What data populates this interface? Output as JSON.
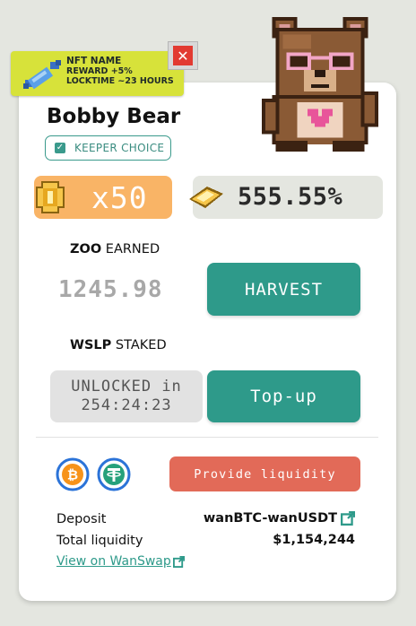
{
  "nft": {
    "name": "NFT NAME",
    "reward": "REWARD +5%",
    "locktime": "LOCKTIME ~23 HOURS"
  },
  "card": {
    "title": "Bobby Bear",
    "keeper_label": "KEEPER CHOICE",
    "multiplier": "x50",
    "apr": "555.55%",
    "earned": {
      "token": "ZOO",
      "suffix": " EARNED",
      "value": "1245.98",
      "button": "HARVEST"
    },
    "staked": {
      "token": "WSLP",
      "suffix": " STAKED",
      "status_line1": "UNLOCKED in",
      "status_line2": "254:24:23",
      "button": "Top-up"
    },
    "provide_button": "Provide liquidity",
    "deposit_label": "Deposit",
    "deposit_value": "wanBTC-wanUSDT",
    "liquidity_label": "Total liquidity",
    "liquidity_value": "$1,154,244",
    "view_link": "View on WanSwap"
  },
  "icons": {
    "candy": "candy-icon",
    "close": "close-icon",
    "coin": "coin-icon",
    "gold": "gold-bar-icon",
    "btc": "bitcoin-icon",
    "usdt": "tether-icon",
    "external": "external-link-icon"
  },
  "colors": {
    "accent": "#2e9a8a",
    "badge": "#d7e23a",
    "multiplier_bg": "#f9b466",
    "provide": "#e26a58",
    "close": "#e23a32"
  }
}
